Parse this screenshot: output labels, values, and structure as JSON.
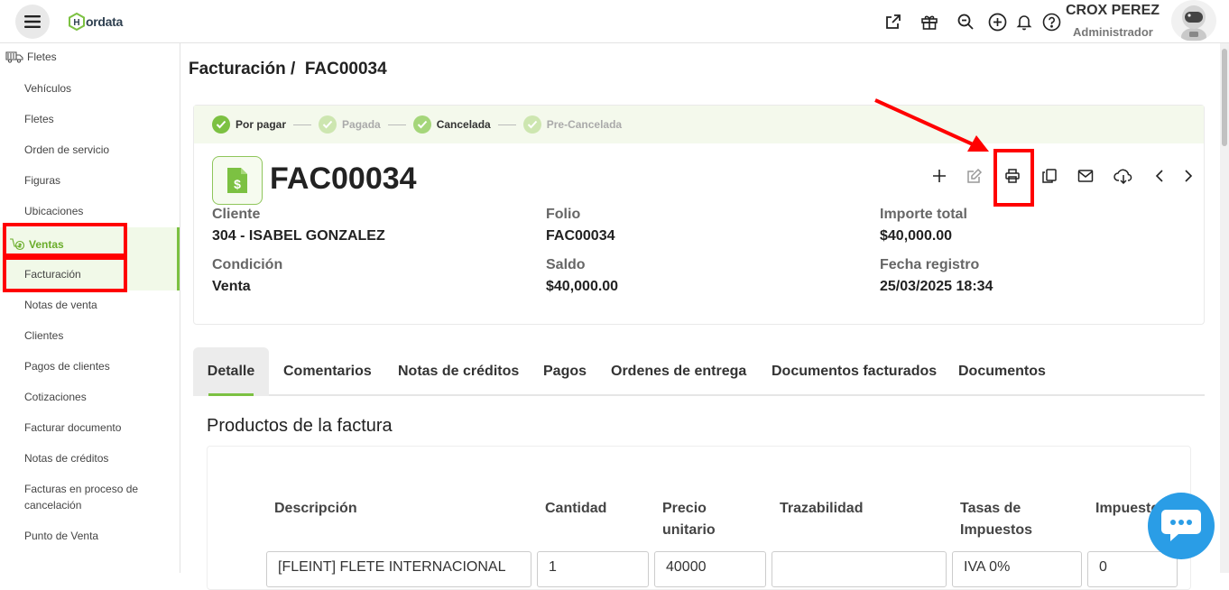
{
  "brand": {
    "name": "ordata",
    "logo_letter": "H"
  },
  "user": {
    "name": "CROX PEREZ",
    "role": "Administrador"
  },
  "topbar_icons": [
    "external-link-icon",
    "gift-icon",
    "zoom-search-icon",
    "plus-circle-icon",
    "bell-icon",
    "help-icon"
  ],
  "sidebar": {
    "header": "Fletes",
    "items_top": [
      "Vehículos",
      "Fletes",
      "Orden de servicio",
      "Figuras",
      "Ubicaciones"
    ],
    "section": "Ventas",
    "active_item": "Facturación",
    "items_bottom": [
      "Notas de venta",
      "Clientes",
      "Pagos de clientes",
      "Cotizaciones",
      "Facturar documento",
      "Notas de créditos"
    ],
    "multi_line_item": [
      "Facturas en proceso de",
      "cancelación"
    ],
    "last_item": "Punto de Venta"
  },
  "breadcrumb": {
    "parent": "Facturación",
    "separator": "/",
    "current": "FAC00034"
  },
  "status_steps": [
    {
      "label": "Por pagar",
      "active": true
    },
    {
      "label": "Pagada",
      "active": false
    },
    {
      "label": "Cancelada",
      "active": true
    },
    {
      "label": "Pre-Cancelada",
      "active": false
    }
  ],
  "invoice": {
    "title": "FAC00034",
    "fields": {
      "cliente_label": "Cliente",
      "cliente_value": "304 - ISABEL GONZALEZ",
      "folio_label": "Folio",
      "folio_value": "FAC00034",
      "importe_label": "Importe total",
      "importe_value": "$40,000.00",
      "condicion_label": "Condición",
      "condicion_value": "Venta",
      "saldo_label": "Saldo",
      "saldo_value": "$40,000.00",
      "fecha_label": "Fecha registro",
      "fecha_value": "25/03/2025 18:34"
    }
  },
  "actions": [
    "add-icon",
    "edit-icon",
    "print-icon",
    "copy-icon",
    "mail-icon",
    "cloud-download-icon",
    "prev-icon",
    "next-icon"
  ],
  "tabs": [
    "Detalle",
    "Comentarios",
    "Notas de créditos",
    "Pagos",
    "Ordenes de entrega",
    "Documentos facturados",
    "Documentos"
  ],
  "products": {
    "title": "Productos de la factura",
    "columns": {
      "descripcion": "Descripción",
      "cantidad": "Cantidad",
      "precio_1": "Precio",
      "precio_2": "unitario",
      "trazabilidad": "Trazabilidad",
      "tasas_1": "Tasas de",
      "tasas_2": "Impuestos",
      "impuestos": "Impuestos"
    },
    "row": {
      "descripcion": "[FLEINT] FLETE INTERNACIONAL",
      "cantidad": "1",
      "precio": "40000",
      "trazabilidad": "",
      "tasas": "IVA 0%",
      "impuestos": "0"
    }
  },
  "colors": {
    "accent": "#7cc142",
    "annotation": "#ff0000",
    "chat": "#2a9de6"
  }
}
